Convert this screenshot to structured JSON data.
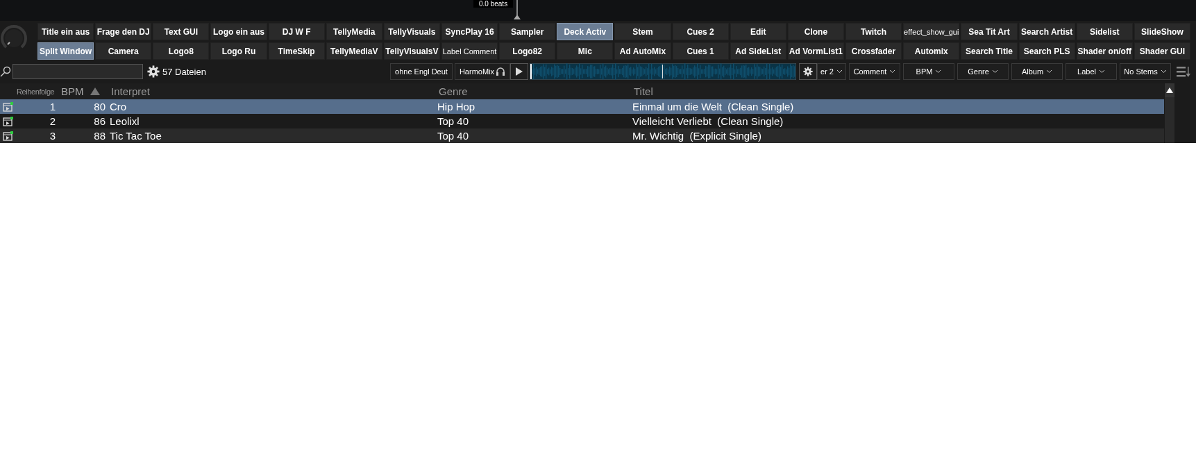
{
  "deck": {
    "beats_label": "0.0 beats"
  },
  "button_rows": [
    [
      {
        "label": "Title ein aus",
        "on": false
      },
      {
        "label": "Frage den DJ",
        "on": false
      },
      {
        "label": "Text GUI",
        "on": false
      },
      {
        "label": "Logo ein aus",
        "on": false
      },
      {
        "label": "DJ W F",
        "on": false
      },
      {
        "label": "TellyMedia",
        "on": false
      },
      {
        "label": "TellyVisuals",
        "on": false
      },
      {
        "label": "SyncPlay 16",
        "on": false
      },
      {
        "label": "Sampler",
        "on": false
      },
      {
        "label": "Deck Activ",
        "on": true
      },
      {
        "label": "Stem",
        "on": false
      },
      {
        "label": "Cues 2",
        "on": false
      },
      {
        "label": "Edit",
        "on": false
      },
      {
        "label": "Clone",
        "on": false
      },
      {
        "label": "Twitch",
        "on": false
      },
      {
        "label": "effect_show_gui",
        "on": false,
        "compact": true
      },
      {
        "label": "Sea Tit Art",
        "on": false
      },
      {
        "label": "Search Artist",
        "on": false
      },
      {
        "label": "Sidelist",
        "on": false
      },
      {
        "label": "SlideShow",
        "on": false
      }
    ],
    [
      {
        "label": "Split Window",
        "on": true
      },
      {
        "label": "Camera",
        "on": false
      },
      {
        "label": "Logo8",
        "on": false
      },
      {
        "label": "Logo Ru",
        "on": false
      },
      {
        "label": "TimeSkip",
        "on": false
      },
      {
        "label": "TellyMediaV",
        "on": false
      },
      {
        "label": "TellyVisualsV",
        "on": false
      },
      {
        "label": "Label Comment",
        "on": false,
        "compact": true
      },
      {
        "label": "Logo82",
        "on": false
      },
      {
        "label": "Mic",
        "on": false
      },
      {
        "label": "Ad AutoMix",
        "on": false
      },
      {
        "label": "Cues 1",
        "on": false
      },
      {
        "label": "Ad SideList",
        "on": false
      },
      {
        "label": "Ad VormList1",
        "on": false
      },
      {
        "label": "Crossfader",
        "on": false
      },
      {
        "label": "Automix",
        "on": false
      },
      {
        "label": "Search Title",
        "on": false
      },
      {
        "label": "Search PLS",
        "on": false
      },
      {
        "label": "Shader on/off",
        "on": false
      },
      {
        "label": "Shader GUI",
        "on": false
      }
    ]
  ],
  "browser": {
    "file_count": "57 Dateien",
    "filter_button": "ohne Engl Deut",
    "harmomix_button": "HarmoMix",
    "dropdowns": [
      "er 2",
      "Comment",
      "BPM",
      "Genre",
      "Album",
      "Label",
      "No Stems"
    ]
  },
  "table": {
    "columns": [
      {
        "label": "Reihenfolge",
        "sorted": false
      },
      {
        "label": "BPM",
        "sorted": true
      },
      {
        "label": "Interpret",
        "sorted": false
      },
      {
        "label": "Genre",
        "sorted": false
      },
      {
        "label": "Titel",
        "sorted": false
      }
    ],
    "rows": [
      {
        "cells": [
          "1",
          "80",
          "Cro",
          "Hip Hop",
          "Einmal um die Welt  (Clean Single)"
        ],
        "selected": true
      },
      {
        "cells": [
          "2",
          "86",
          "Leolixl",
          "Top 40",
          "Vielleicht Verliebt  (Clean Single)"
        ],
        "selected": false
      },
      {
        "cells": [
          "3",
          "88",
          "Tic Tac Toe",
          "Top 40",
          "Mr. Wichtig  (Explicit Single)"
        ],
        "selected": false
      }
    ]
  }
}
